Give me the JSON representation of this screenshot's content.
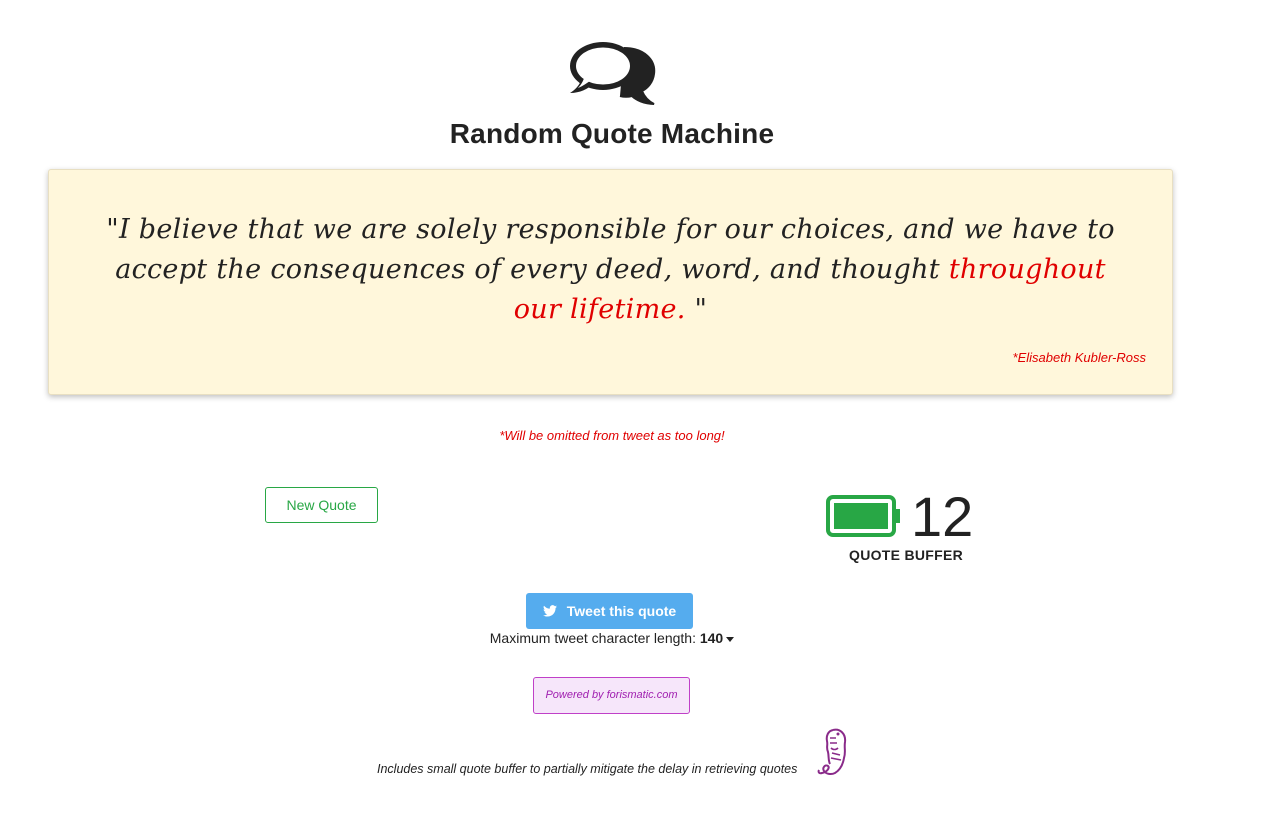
{
  "header": {
    "logo_icon": "comments-icon",
    "title": "Random Quote Machine"
  },
  "quote": {
    "text_main": "\"I believe that we are solely responsible for our choices, and we have to accept the consequences of every deed, word, and thought ",
    "text_overflow": "throughout our lifetime.",
    "text_close": " \"",
    "author": "*Elisabeth Kubler-Ross",
    "overflow_color": "#e00000"
  },
  "omit_note": "*Will be omitted from tweet as too long!",
  "controls": {
    "new_quote_label": "New Quote",
    "buffer_icon": "battery-full-icon",
    "buffer_count": "12",
    "buffer_label": "QUOTE BUFFER",
    "tweet_icon": "twitter-icon",
    "tweet_label": "Tweet this quote",
    "tweet_length_label": "Maximum tweet character length: ",
    "tweet_length_value": "140"
  },
  "powered_by": "Powered by forismatic.com",
  "footer": {
    "note": "Includes small quote buffer to partially mitigate the delay in retrieving quotes",
    "icon": "forismatic-logo-icon"
  },
  "colors": {
    "card_background": "#fff7db",
    "accent_green": "#28a745",
    "twitter_blue": "#55acee",
    "powered_purple": "#a020b0"
  }
}
